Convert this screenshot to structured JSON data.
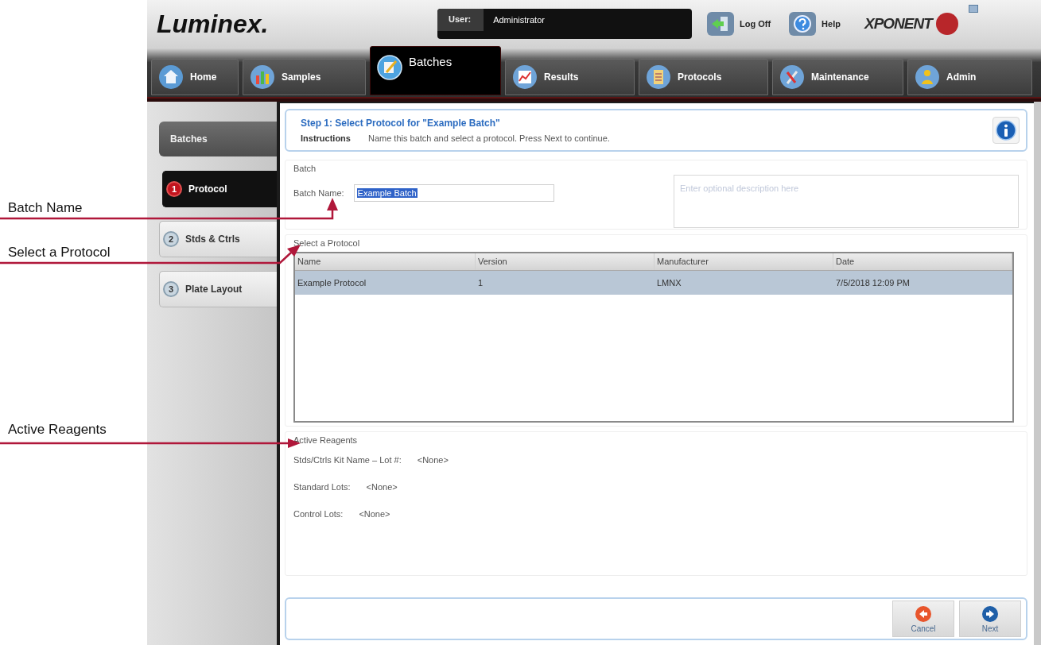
{
  "callouts": [
    {
      "label": "Batch Name"
    },
    {
      "label": "Select a Protocol"
    },
    {
      "label": "Active Reagents"
    }
  ],
  "header": {
    "logo": "Luminex.",
    "user_label": "User:",
    "user": "Administrator",
    "log_off": "Log Off",
    "help": "Help",
    "brand": "XPONENT"
  },
  "tabs": [
    {
      "label": "Home",
      "selected": false
    },
    {
      "label": "Samples",
      "selected": false
    },
    {
      "label": "Batches",
      "selected": true
    },
    {
      "label": "Results",
      "selected": false
    },
    {
      "label": "Protocols",
      "selected": false
    },
    {
      "label": "Maintenance",
      "selected": false
    },
    {
      "label": "Admin",
      "selected": false
    }
  ],
  "sidebar": {
    "title": "Batches",
    "steps": [
      {
        "number": "1",
        "label": "Protocol",
        "selected": true
      },
      {
        "number": "2",
        "label": "Stds & Ctrls",
        "selected": false
      },
      {
        "number": "3",
        "label": "Plate Layout",
        "selected": false
      }
    ]
  },
  "instructions": {
    "title": "Step 1: Select Protocol for \"Example Batch\"",
    "label": "Instructions",
    "text": "Name this batch and select a protocol. Press Next to continue."
  },
  "batch": {
    "group_label": "Batch",
    "name_label": "Batch Name:",
    "name_value": "Example Batch",
    "text_selected": true,
    "description_placeholder": "Enter optional description here"
  },
  "protocols": {
    "group_label": "Select a Protocol",
    "columns": [
      "Name",
      "Version",
      "Manufacturer",
      "Date"
    ],
    "rows": [
      {
        "cells": [
          "Example Protocol",
          "1",
          "LMNX",
          "7/5/2018 12:09 PM"
        ],
        "selected": true
      }
    ]
  },
  "reagents": {
    "group_label": "Active Reagents",
    "items": [
      {
        "label": "Stds/Ctrls Kit Name – Lot #:",
        "value": "<None>"
      },
      {
        "label": "Standard Lots:",
        "value": "<None>"
      },
      {
        "label": "Control Lots:",
        "value": "<None>"
      }
    ]
  },
  "buttons": [
    {
      "label": "Cancel",
      "kind": "cancel"
    },
    {
      "label": "Next",
      "kind": "next"
    }
  ]
}
